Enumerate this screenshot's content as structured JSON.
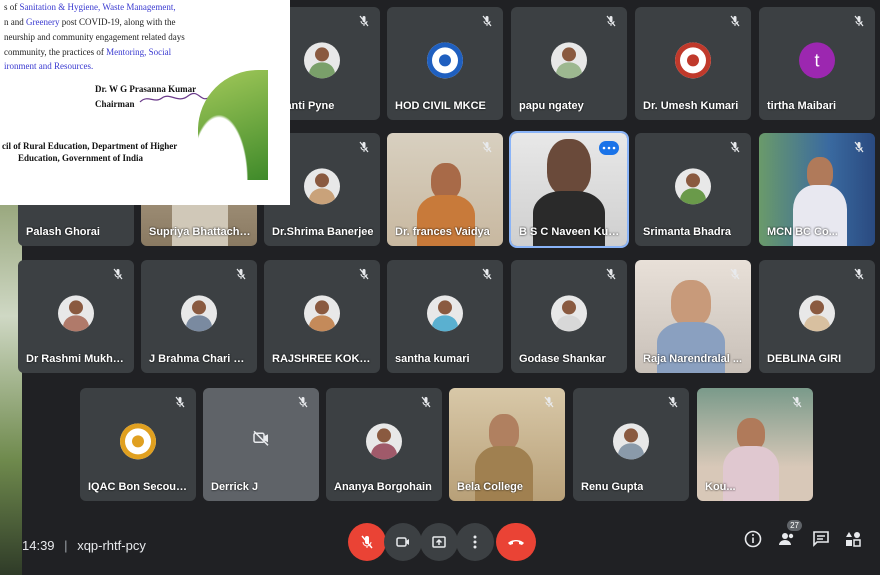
{
  "document": {
    "lines": [
      {
        "pre": "s of ",
        "hl": "Sanitation & Hygiene, Waste Management,",
        "post": ""
      },
      {
        "pre": "n and ",
        "hl": "Greenery",
        "post": " post COVID-19, along with the"
      },
      {
        "pre": "neurship and community engagement related days",
        "hl": "",
        "post": ""
      },
      {
        "pre": "community, the practices of ",
        "hl": "Mentoring, Social",
        "post": ""
      },
      {
        "pre": "",
        "hl": "ironment and Resources.",
        "post": ""
      }
    ],
    "signatory_name": "Dr. W G Prasanna Kumar",
    "signatory_title": "Chairman",
    "org_line1": "cil of Rural Education, Department of Higher",
    "org_line2": "Education, Government of India"
  },
  "participants": [
    {
      "name": "obanti Pyne",
      "avatar": "photo",
      "color": "#7aa06a"
    },
    {
      "name": "HOD CIVIL MKCE",
      "avatar": "logo",
      "color": "#1f5fbf"
    },
    {
      "name": "papu ngatey",
      "avatar": "photo",
      "color": "#9db890"
    },
    {
      "name": "Dr. Umesh Kumari",
      "avatar": "logo",
      "color": "#c0392b"
    },
    {
      "name": "tirtha Maibari",
      "avatar": "letter",
      "letter": "t",
      "color": "#9c27b0"
    },
    {
      "name": "Palash Ghorai",
      "avatar": "none"
    },
    {
      "name": "Supriya Bhattacha...",
      "avatar": "video"
    },
    {
      "name": "Dr.Shrima Banerjee",
      "avatar": "photo",
      "color": "#c9a27a"
    },
    {
      "name": "Dr. frances Vaidya",
      "avatar": "video"
    },
    {
      "name": "B S C Naveen Kum...",
      "avatar": "video"
    },
    {
      "name": "Srimanta Bhadra",
      "avatar": "photo",
      "color": "#6a9a4a"
    },
    {
      "name": "MCN BC Co...",
      "avatar": "video"
    },
    {
      "name": "Dr Rashmi Mukherjee",
      "avatar": "photo",
      "color": "#b07a6a"
    },
    {
      "name": "J Brahma Chari Kan...",
      "avatar": "photo",
      "color": "#7a8aa0"
    },
    {
      "name": "RAJSHREE KOKATE",
      "avatar": "photo",
      "color": "#c48a5a"
    },
    {
      "name": "santha kumari",
      "avatar": "photo",
      "color": "#5ab0d0"
    },
    {
      "name": "Godase Shankar",
      "avatar": "photo",
      "color": "#d8d8d8"
    },
    {
      "name": "Raja Narendralal ...",
      "avatar": "video"
    },
    {
      "name": "DEBLINA GIRI",
      "avatar": "photo",
      "color": "#d8c0a0"
    },
    {
      "name": "IQAC Bon Secours ...",
      "avatar": "logo",
      "color": "#e0a020"
    },
    {
      "name": "Derrick J",
      "avatar": "camera-off"
    },
    {
      "name": "Ananya Borgohain",
      "avatar": "photo",
      "color": "#a05a6a"
    },
    {
      "name": "Bela College",
      "avatar": "video"
    },
    {
      "name": "Renu Gupta",
      "avatar": "photo",
      "color": "#8a9aaa"
    },
    {
      "name": "Kou...",
      "avatar": "video"
    }
  ],
  "footer": {
    "time": "14:39",
    "separator": "|",
    "meeting_code": "xqp-rhtf-pcy",
    "participant_count": "27"
  },
  "icons": {
    "mic_off": "mic-off-icon",
    "camera": "camera-icon",
    "present": "present-icon",
    "more": "more-vert-icon",
    "end_call": "end-call-icon",
    "info": "info-icon",
    "people": "people-icon",
    "chat": "chat-icon",
    "activities": "activities-icon"
  },
  "colors": {
    "background": "#202124",
    "tile": "#3c4043",
    "end_call": "#ea4335",
    "active_speaker": "#8ab4f8"
  }
}
